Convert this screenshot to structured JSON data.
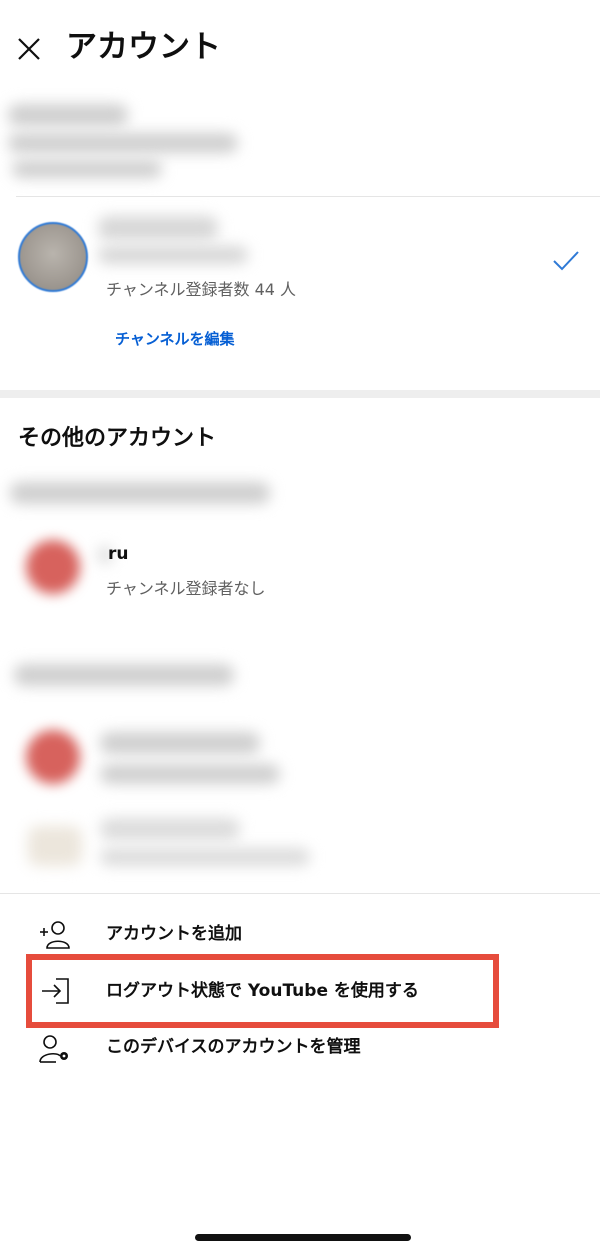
{
  "header": {
    "title": "アカウント"
  },
  "current_account": {
    "subscribers": "チャンネル登録者数 44 人",
    "edit_channel": "チャンネルを編集"
  },
  "other_accounts": {
    "title": "その他のアカウント",
    "items": [
      {
        "name": "ru",
        "subscribers": "チャンネル登録者なし"
      }
    ]
  },
  "actions": {
    "add_account": "アカウントを追加",
    "logout_mode": "ログアウト状態で YouTube を使用する",
    "manage_accounts": "このデバイスのアカウントを管理"
  },
  "colors": {
    "link": "#065fd4",
    "highlight": "#e64c3c",
    "avatar_ring": "#2f7ad6"
  },
  "icons": [
    "close-icon",
    "checkmark-icon",
    "add-person-icon",
    "sign-in-icon",
    "manage-person-gear-icon"
  ]
}
